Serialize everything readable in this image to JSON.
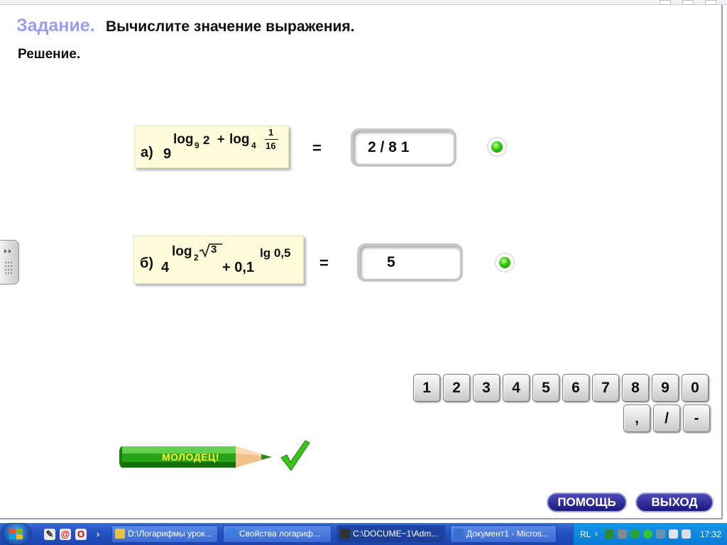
{
  "task": {
    "label": "Задание.",
    "text": "Вычислите значение выражения."
  },
  "solution_label": "Решение.",
  "problem_a": {
    "label": "а)",
    "base": "9",
    "log1": "log",
    "log1_base": "9",
    "log1_arg": "2",
    "plus": "+",
    "log2": "log",
    "log2_base": "4",
    "frac_num": "1",
    "frac_den": "16",
    "equals": "=",
    "answer": "2 /  8 1",
    "status_color": "#2dc40a"
  },
  "problem_b": {
    "label": "б)",
    "base": "4",
    "log1": "log",
    "log1_base": "2",
    "sqrt_arg": "3",
    "term2": "+ 0,1",
    "exp2": "lg 0,5",
    "equals": "=",
    "answer": "5",
    "status_color": "#2dc40a"
  },
  "keypad": {
    "row1": [
      "1",
      "2",
      "3",
      "4",
      "5",
      "6",
      "7",
      "8",
      "9",
      "0"
    ],
    "row2": [
      ",",
      "/",
      "-"
    ]
  },
  "praise": "МОЛОДЕЦ!",
  "buttons": {
    "help": "ПОМОЩЬ",
    "exit": "ВЫХОД"
  },
  "taskbar": {
    "windows": [
      {
        "label": "D:\\Логарифмы урок...",
        "active": false
      },
      {
        "label": "Свойства логариф...",
        "active": false
      },
      {
        "label": "C:\\DOCUME~1\\Adm...",
        "active": true
      },
      {
        "label": "Документ1 - Micros...",
        "active": false
      }
    ],
    "tray_lang": "RL",
    "clock": "17:32"
  }
}
